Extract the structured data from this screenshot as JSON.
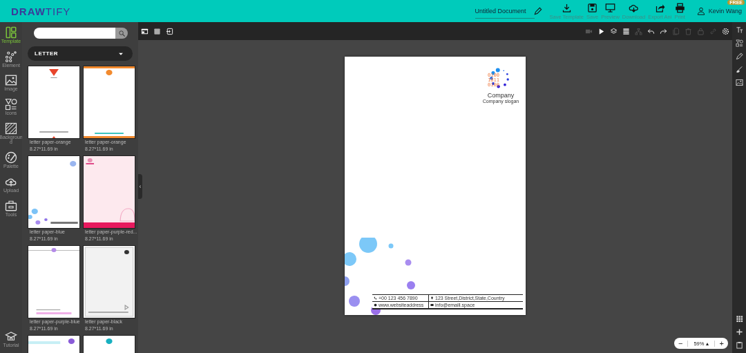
{
  "header": {
    "logo": "**DRAW**TIFY",
    "document_title": "Untitled Document",
    "actions": [
      {
        "label": "Save Template"
      },
      {
        "label": "Save"
      },
      {
        "label": "Preview"
      },
      {
        "label": "Download"
      },
      {
        "label": "Export Ani"
      },
      {
        "label": "Print"
      }
    ],
    "user": {
      "name": "Kevin Wang",
      "badge": "FREE"
    }
  },
  "rail": [
    {
      "label": "Template",
      "selected": true
    },
    {
      "label": "Element",
      "selected": false
    },
    {
      "label": "Image",
      "selected": false
    },
    {
      "label": "Icons",
      "selected": false
    },
    {
      "label": "Backgroun\nd",
      "selected": false
    },
    {
      "label": "Palette",
      "selected": false
    },
    {
      "label": "Upload",
      "selected": false
    },
    {
      "label": "Tools",
      "selected": false
    }
  ],
  "tutorial": {
    "label": "Tutorial"
  },
  "category": "LETTER",
  "templates": [
    {
      "name": "letter paper-orange",
      "size": "8.27*11.69 in",
      "kind": "triangle"
    },
    {
      "name": "letter paper-orange",
      "size": "8.27*11.69 in",
      "kind": "orange"
    },
    {
      "name": "letter paper-blue",
      "size": "8.27*11.69 in",
      "kind": "bubbles"
    },
    {
      "name": "letter paper-purple-red...",
      "size": "8.27*11.69 in",
      "kind": "cupcake"
    },
    {
      "name": "letter paper-purple-blue",
      "size": "8.27*11.69 in",
      "kind": "purple"
    },
    {
      "name": "letter paper-black",
      "size": "8.27*11.69 in",
      "kind": "gray"
    },
    {
      "kind": "cyan"
    },
    {
      "kind": "teal"
    }
  ],
  "toolbar_right": [
    {
      "disabled": true
    },
    {
      "disabled": false
    },
    {
      "disabled": false
    },
    {
      "disabled": false
    },
    {
      "disabled": true
    },
    {
      "disabled": false
    },
    {
      "disabled": false
    },
    {
      "disabled": true
    },
    {
      "disabled": true
    },
    {
      "disabled": true
    },
    {
      "disabled": true
    },
    {
      "disabled": false
    }
  ],
  "collapse_handle": "‹",
  "page": {
    "logo_code": [
      "0100",
      "1011",
      "0100"
    ],
    "company": "Company",
    "slogan": "Company slogan",
    "contacts": [
      {
        "text": "+00 123 456 7890"
      },
      {
        "text": "123 Street,District,State,Country"
      },
      {
        "text": "www.websiteaddress"
      },
      {
        "text": "info@emaill.space"
      }
    ]
  },
  "zoom": {
    "minus": "−",
    "value": "59%",
    "caret": "▴",
    "plus": "+"
  }
}
